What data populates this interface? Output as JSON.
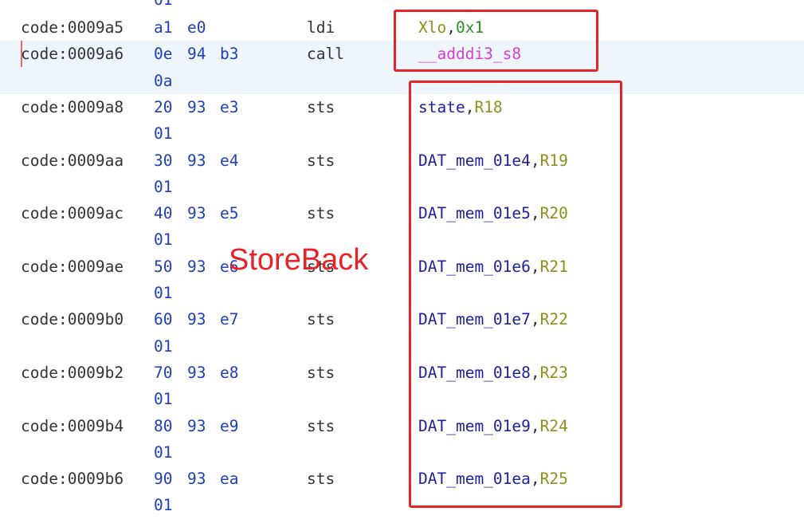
{
  "top_fragment": "01",
  "rows": [
    {
      "addr": "code:0009a5",
      "b1": "a1",
      "b2": "e0",
      "b3": "",
      "cont": "",
      "mnemonic": "ldi",
      "op1": "Xlo",
      "op_sep": ",",
      "op2": "0x1",
      "selected": false
    },
    {
      "addr": "code:0009a6",
      "b1": "0e",
      "b2": "94",
      "b3": "b3",
      "cont": "0a",
      "mnemonic": "call",
      "op1": "__adddi3_s8",
      "op_sep": "",
      "op2": "",
      "selected": true
    },
    {
      "addr": "code:0009a8",
      "b1": "20",
      "b2": "93",
      "b3": "e3",
      "cont": "01",
      "mnemonic": "sts",
      "op1": "state",
      "op_sep": ",",
      "op2": "R18",
      "selected": false
    },
    {
      "addr": "code:0009aa",
      "b1": "30",
      "b2": "93",
      "b3": "e4",
      "cont": "01",
      "mnemonic": "sts",
      "op1": "DAT_mem_01e4",
      "op_sep": ",",
      "op2": "R19",
      "selected": false
    },
    {
      "addr": "code:0009ac",
      "b1": "40",
      "b2": "93",
      "b3": "e5",
      "cont": "01",
      "mnemonic": "sts",
      "op1": "DAT_mem_01e5",
      "op_sep": ",",
      "op2": "R20",
      "selected": false
    },
    {
      "addr": "code:0009ae",
      "b1": "50",
      "b2": "93",
      "b3": "e6",
      "cont": "01",
      "mnemonic": "sts",
      "op1": "DAT_mem_01e6",
      "op_sep": ",",
      "op2": "R21",
      "selected": false
    },
    {
      "addr": "code:0009b0",
      "b1": "60",
      "b2": "93",
      "b3": "e7",
      "cont": "01",
      "mnemonic": "sts",
      "op1": "DAT_mem_01e7",
      "op_sep": ",",
      "op2": "R22",
      "selected": false
    },
    {
      "addr": "code:0009b2",
      "b1": "70",
      "b2": "93",
      "b3": "e8",
      "cont": "01",
      "mnemonic": "sts",
      "op1": "DAT_mem_01e8",
      "op_sep": ",",
      "op2": "R23",
      "selected": false
    },
    {
      "addr": "code:0009b4",
      "b1": "80",
      "b2": "93",
      "b3": "e9",
      "cont": "01",
      "mnemonic": "sts",
      "op1": "DAT_mem_01e9",
      "op_sep": ",",
      "op2": "R24",
      "selected": false
    },
    {
      "addr": "code:0009b6",
      "b1": "90",
      "b2": "93",
      "b3": "ea",
      "cont": "01",
      "mnemonic": "sts",
      "op1": "DAT_mem_01ea",
      "op_sep": ",",
      "op2": "R25",
      "selected": false
    }
  ],
  "annotation": "StoreBack",
  "colors": {
    "highlight_box": "#e5242a",
    "selected_row_bg": "#eef6fc",
    "bytes": "#1f3fb5",
    "label": "#20209a",
    "register": "#8f8f1a",
    "number": "#2d8f2d",
    "function": "#d43fcf"
  }
}
